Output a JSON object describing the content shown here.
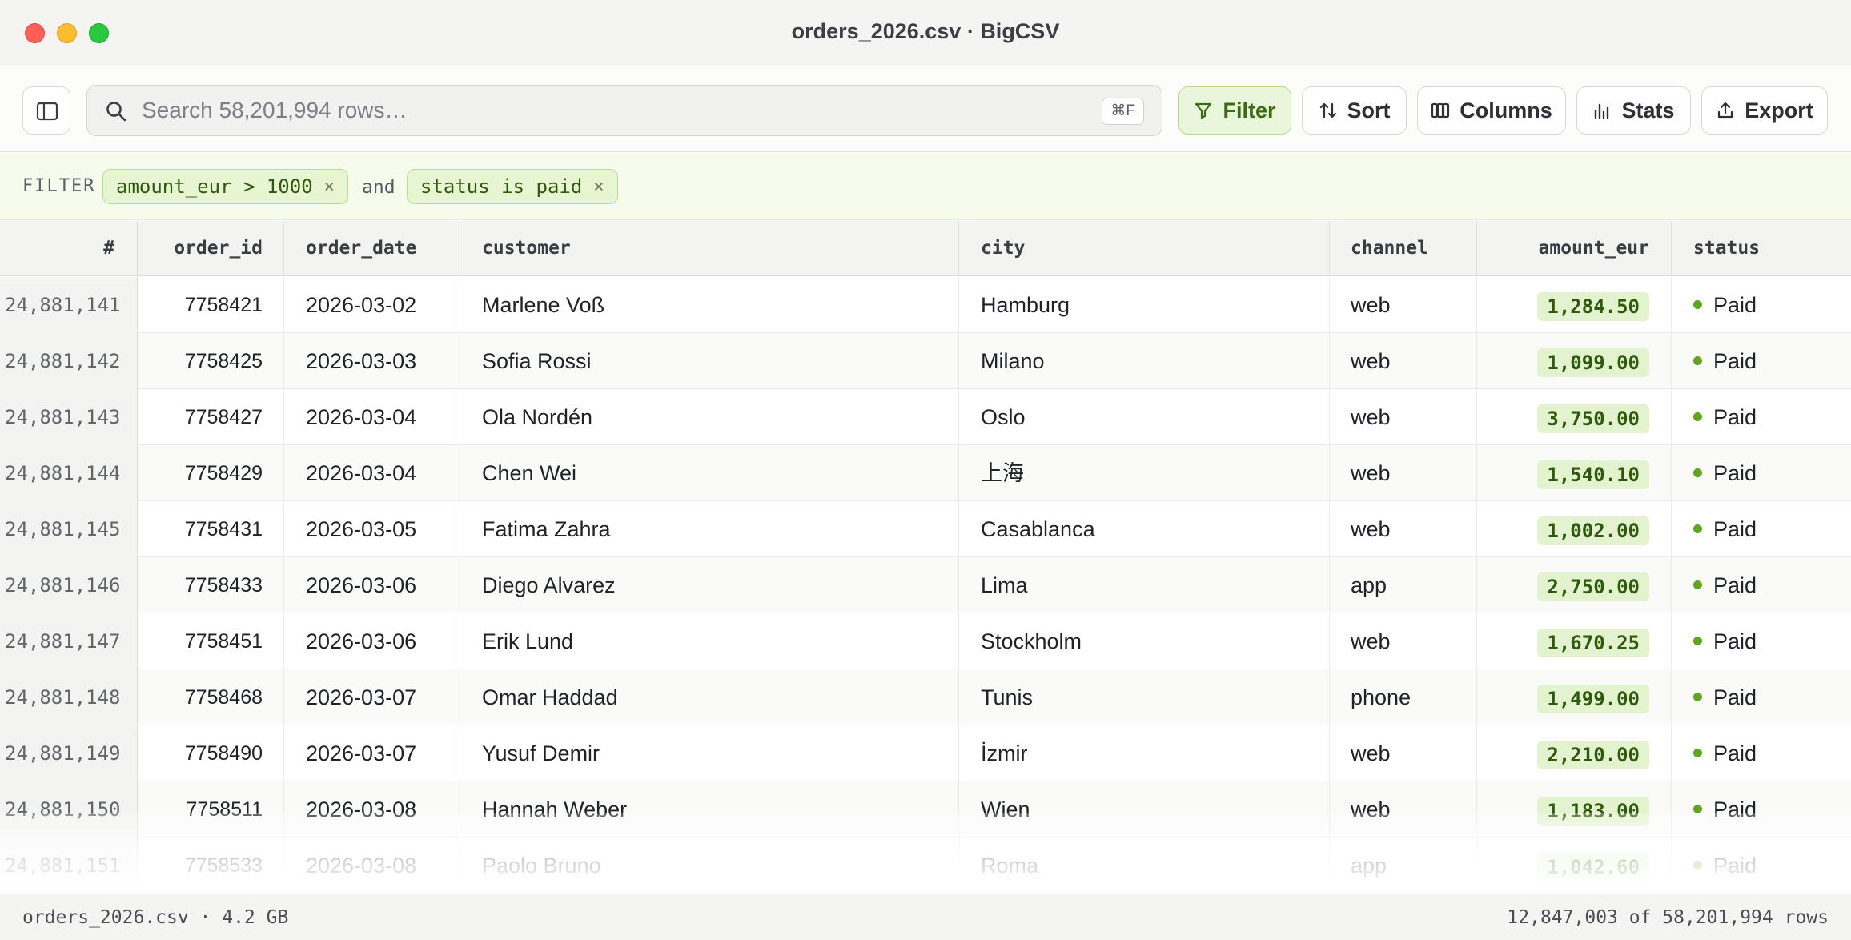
{
  "window": {
    "title": "orders_2026.csv · BigCSV"
  },
  "toolbar": {
    "search_placeholder": "Search 58,201,994 rows…",
    "search_shortcut": "⌘F",
    "filter_label": "Filter",
    "sort_label": "Sort",
    "columns_label": "Columns",
    "stats_label": "Stats",
    "export_label": "Export"
  },
  "filterbar": {
    "label": "FILTER",
    "conditions": [
      "amount_eur > 1000",
      "status is paid"
    ],
    "joiner": "and",
    "remove_glyph": "×"
  },
  "grid": {
    "columns": [
      "#",
      "order_id",
      "order_date",
      "customer",
      "city",
      "channel",
      "amount_eur",
      "status"
    ],
    "rows": [
      {
        "idx": "24,881,141",
        "order_id": "7758421",
        "order_date": "2026-03-02",
        "customer": "Marlene Voß",
        "city": "Hamburg",
        "channel": "web",
        "amount": "1,284.50",
        "status": "Paid"
      },
      {
        "idx": "24,881,142",
        "order_id": "7758425",
        "order_date": "2026-03-03",
        "customer": "Sofia Rossi",
        "city": "Milano",
        "channel": "web",
        "amount": "1,099.00",
        "status": "Paid"
      },
      {
        "idx": "24,881,143",
        "order_id": "7758427",
        "order_date": "2026-03-04",
        "customer": "Ola Nordén",
        "city": "Oslo",
        "channel": "web",
        "amount": "3,750.00",
        "status": "Paid"
      },
      {
        "idx": "24,881,144",
        "order_id": "7758429",
        "order_date": "2026-03-04",
        "customer": "Chen Wei",
        "city": "上海",
        "channel": "web",
        "amount": "1,540.10",
        "status": "Paid"
      },
      {
        "idx": "24,881,145",
        "order_id": "7758431",
        "order_date": "2026-03-05",
        "customer": "Fatima Zahra",
        "city": "Casablanca",
        "channel": "web",
        "amount": "1,002.00",
        "status": "Paid"
      },
      {
        "idx": "24,881,146",
        "order_id": "7758433",
        "order_date": "2026-03-06",
        "customer": "Diego Alvarez",
        "city": "Lima",
        "channel": "app",
        "amount": "2,750.00",
        "status": "Paid"
      },
      {
        "idx": "24,881,147",
        "order_id": "7758451",
        "order_date": "2026-03-06",
        "customer": "Erik Lund",
        "city": "Stockholm",
        "channel": "web",
        "amount": "1,670.25",
        "status": "Paid"
      },
      {
        "idx": "24,881,148",
        "order_id": "7758468",
        "order_date": "2026-03-07",
        "customer": "Omar Haddad",
        "city": "Tunis",
        "channel": "phone",
        "amount": "1,499.00",
        "status": "Paid"
      },
      {
        "idx": "24,881,149",
        "order_id": "7758490",
        "order_date": "2026-03-07",
        "customer": "Yusuf Demir",
        "city": "İzmir",
        "channel": "web",
        "amount": "2,210.00",
        "status": "Paid"
      },
      {
        "idx": "24,881,150",
        "order_id": "7758511",
        "order_date": "2026-03-08",
        "customer": "Hannah Weber",
        "city": "Wien",
        "channel": "web",
        "amount": "1,183.00",
        "status": "Paid"
      },
      {
        "idx": "24,881,151",
        "order_id": "7758533",
        "order_date": "2026-03-08",
        "customer": "Paolo Bruno",
        "city": "Roma",
        "channel": "app",
        "amount": "1,042.60",
        "status": "Paid"
      }
    ]
  },
  "statusbar": {
    "file_info": "orders_2026.csv · 4.2 GB",
    "row_count": "12,847,003 of 58,201,994 rows"
  },
  "colors": {
    "accent_green": "#5fa61d",
    "chip_bg": "#e7f5d3",
    "traffic_red": "#fe5f57",
    "traffic_yellow": "#febc2e",
    "traffic_green": "#28c840"
  }
}
